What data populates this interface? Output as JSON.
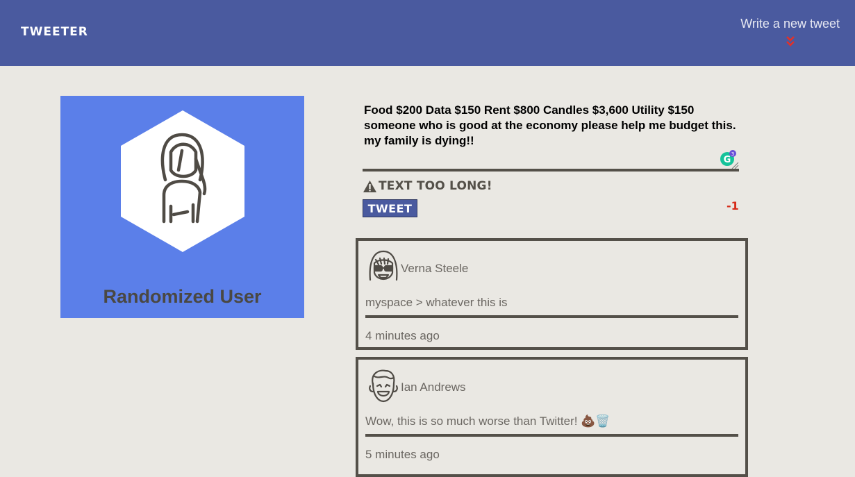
{
  "nav": {
    "brand": "TWEETER",
    "compose_toggle": "Write a new tweet",
    "compose_icon": "double-chevron-down-icon",
    "background_color": "#4a5a9f"
  },
  "profile": {
    "name": "Randomized User",
    "card_color": "#5b7fe9"
  },
  "composer": {
    "text": "Food $200 Data $150 Rent $800 Candles $3,600 Utility $150 someone who is good at the economy please help me budget this. my family is dying!!",
    "grammarly_count": "3",
    "error": "TEXT TOO LONG!",
    "error_icon": "warning-icon",
    "button_label": "TWEET",
    "counter": "-1",
    "counter_color": "#d62c1a"
  },
  "tweets": [
    {
      "author": "Verna Steele",
      "body": "myspace > whatever this is",
      "time": "4 minutes ago",
      "avatar": "woman-glasses-avatar"
    },
    {
      "author": "Ian Andrews",
      "body": "Wow, this is so much worse than Twitter! 💩🗑️",
      "time": "5 minutes ago",
      "avatar": "man-smiling-avatar"
    }
  ]
}
